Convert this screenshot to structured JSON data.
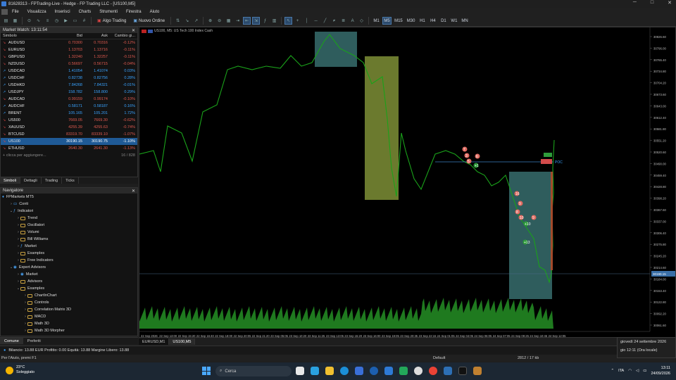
{
  "window": {
    "title": "81628313 - FPTrading-Live - Hedge - FP Trading LLC - [US100,M5]",
    "minimize": "─",
    "maximize": "□",
    "close": "✕"
  },
  "menu": [
    "File",
    "Visualizza",
    "Inserisci",
    "Charts",
    "Strumenti",
    "Finestra",
    "Aiuto"
  ],
  "toolbar": {
    "algo": "Algo Trading",
    "new_order": "Nuovo Ordine",
    "timeframes": [
      "M1",
      "M5",
      "M15",
      "M30",
      "H1",
      "H4",
      "D1",
      "W1",
      "MN"
    ],
    "active_timeframe": "M5"
  },
  "market_watch": {
    "title": "Market Watch: 13:11:54",
    "headers": {
      "symbol": "Simbolo",
      "bid": "Bid",
      "ask": "Ask",
      "change": "Cambio gi..."
    },
    "rows": [
      {
        "s": "AUDUSD",
        "bid": "0.70300",
        "ask": "0.70316",
        "ch": "-0.12%",
        "d": "dn"
      },
      {
        "s": "EURUSD",
        "bid": "1.13703",
        "ask": "1.13716",
        "ch": "-0.11%",
        "d": "dn"
      },
      {
        "s": "GBPUSD",
        "bid": "1.32240",
        "ask": "1.32257",
        "ch": "-0.11%",
        "d": "dn"
      },
      {
        "s": "NZDUSD",
        "bid": "0.56697",
        "ask": "0.56715",
        "ch": "-0.04%",
        "d": "dn"
      },
      {
        "s": "USDCAD",
        "bid": "1.41054",
        "ask": "1.41074",
        "ch": "0.03%",
        "d": "up"
      },
      {
        "s": "USDCHF",
        "bid": "0.82738",
        "ask": "0.82756",
        "ch": "0.28%",
        "d": "up"
      },
      {
        "s": "USDHKD",
        "bid": "7.84268",
        "ask": "7.84321",
        "ch": "-0.01%",
        "d": "up"
      },
      {
        "s": "USDJPY",
        "bid": "158.782",
        "ask": "158.800",
        "ch": "0.29%",
        "d": "up"
      },
      {
        "s": "AUDCAD",
        "bid": "0.99159",
        "ask": "0.99174",
        "ch": "-0.10%",
        "d": "dn"
      },
      {
        "s": "AUDCHF",
        "bid": "0.58171",
        "ask": "0.58187",
        "ch": "0.16%",
        "d": "up"
      },
      {
        "s": "BRENT",
        "bid": "105.165",
        "ask": "105.201",
        "ch": "1.72%",
        "d": "up"
      },
      {
        "s": "US500",
        "bid": "7669.05",
        "ask": "7669.30",
        "ch": "-0.62%",
        "d": "dn"
      },
      {
        "s": "XAUUSD",
        "bid": "4255.39",
        "ask": "4255.63",
        "ch": "-0.74%",
        "d": "dn"
      },
      {
        "s": "BTCUSD",
        "bid": "83319.70",
        "ask": "83339.10",
        "ch": "-1.07%",
        "d": "dn"
      },
      {
        "s": "US100",
        "bid": "30190.15",
        "ask": "30190.75",
        "ch": "-1.10%",
        "d": "dn",
        "sel": true
      },
      {
        "s": "ETHUSD",
        "bid": "2640.30",
        "ask": "2641.30",
        "ch": "-1.13%",
        "d": "dn"
      }
    ],
    "add": "+ clicca per aggiungere...",
    "count": "16 / 828",
    "tabs": [
      "Simboli",
      "Dettagli",
      "Trading",
      "Ticks"
    ]
  },
  "navigator": {
    "title": "Navigatore",
    "items": [
      {
        "l": "FPMarkets MT5",
        "lv": 0,
        "t": "root"
      },
      {
        "l": "Conti",
        "lv": 1,
        "t": "acc"
      },
      {
        "l": "Indicatori",
        "lv": 1,
        "t": "ind",
        "open": true
      },
      {
        "l": "Trend",
        "lv": 2,
        "t": "f"
      },
      {
        "l": "Oscillatori",
        "lv": 2,
        "t": "f"
      },
      {
        "l": "Volumi",
        "lv": 2,
        "t": "f"
      },
      {
        "l": "Bill Williams",
        "lv": 2,
        "t": "f"
      },
      {
        "l": "Market",
        "lv": 2,
        "t": "ind"
      },
      {
        "l": "Examples",
        "lv": 2,
        "t": "f"
      },
      {
        "l": "Free Indicators",
        "lv": 2,
        "t": "f"
      },
      {
        "l": "Expert Advisors",
        "lv": 1,
        "t": "ea",
        "open": true
      },
      {
        "l": "Market",
        "lv": 2,
        "t": "ea"
      },
      {
        "l": "Advisors",
        "lv": 2,
        "t": "f"
      },
      {
        "l": "Examples",
        "lv": 2,
        "t": "f",
        "open": true
      },
      {
        "l": "ChartInChart",
        "lv": 3,
        "t": "f"
      },
      {
        "l": "Controls",
        "lv": 3,
        "t": "f"
      },
      {
        "l": "Correlation Matrix 3D",
        "lv": 3,
        "t": "f"
      },
      {
        "l": "MACD",
        "lv": 3,
        "t": "f"
      },
      {
        "l": "Math 3D",
        "lv": 3,
        "t": "f"
      },
      {
        "l": "Math 3D Morpher",
        "lv": 3,
        "t": "f"
      }
    ],
    "tabs": [
      "Comune",
      "Preferiti"
    ]
  },
  "chart": {
    "header": "US100, M5: US Tech 100 Index Cash",
    "poc": "POC",
    "price_tag": "30190.15",
    "yticks": [
      "30826.60",
      "30796.00",
      "30765.40",
      "30734.80",
      "30704.20",
      "30673.60",
      "30643.00",
      "30612.40",
      "30581.80",
      "30551.20",
      "30520.60",
      "30490.00",
      "30459.40",
      "30428.80",
      "30398.20",
      "30367.60",
      "30337.00",
      "30306.40",
      "30275.80",
      "30245.20",
      "30214.60",
      "30184.00",
      "30153.40",
      "30122.80",
      "30092.20",
      "30061.60"
    ],
    "xticks": [
      "22 Sep 2026",
      "22 Sep 13:00",
      "22 Sep 15:20",
      "22 Sep 16:40",
      "22 Sep 18:00",
      "22 Sep 20:05",
      "22 Sep 21:20",
      "23 Sep 05:05",
      "23 Sep 10:20",
      "23 Sep 11:25",
      "23 Sep 13:05",
      "23 Sep 15:20",
      "23 Sep 16:00",
      "23 Sep 19:05",
      "23 Sep 20:35",
      "23 Sep 22:15",
      "24 Sep 01:05",
      "24 Sep 04:05",
      "24 Sep 06:05",
      "24 Sep 07:05",
      "24 Sep 09:25",
      "24 Sep 10:45",
      "24 Sep 12:05"
    ],
    "labels": [
      "7",
      "3",
      "6",
      "5",
      "+1",
      "16",
      "9",
      "8",
      "10",
      "9",
      "+10",
      "+13"
    ],
    "tabs": [
      "EURUSD,M1",
      "US100,M5"
    ]
  },
  "balance": "Bilancio: 13.88 EUR  Profitto: 0.00  Equità: 13.88  Margine Libero: 13.88",
  "status": {
    "help": "Per l'Aiuto, premi F1",
    "profile": "Default",
    "stats": "2812 / 17 kb"
  },
  "datetip": {
    "line1": "giovedì 24 settembre 2026",
    "line2": "gio 12:11 (Ora locale)"
  },
  "taskbar": {
    "temp": "23°C",
    "cond": "Soleggiato",
    "search": "Cerca",
    "lang": "ITA",
    "time": "13:11",
    "date": "24/09/2026"
  },
  "colors": {
    "line": "#1aa11a",
    "box_teal": "#2f5d5d",
    "box_olive": "#6b7a2e",
    "poc_line": "#3a7fc0"
  }
}
